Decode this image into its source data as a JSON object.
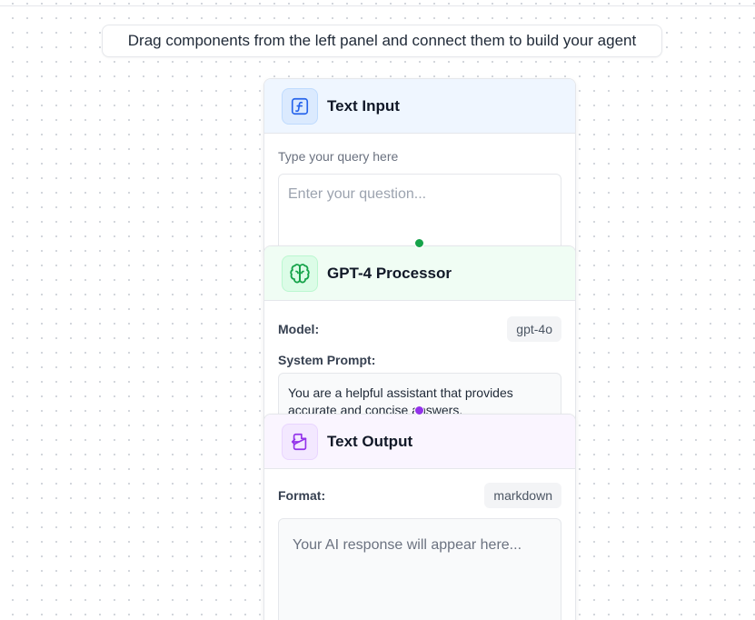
{
  "canvas": {
    "hint_text": "Drag components from the left panel and connect them to build your agent"
  },
  "nodes": {
    "text_input": {
      "title": "Text Input",
      "icon": "function-icon",
      "field_label": "Type your query here",
      "input_placeholder": "Enter your question...",
      "accent": "#2563eb"
    },
    "gpt": {
      "title": "GPT-4 Processor",
      "icon": "brain-icon",
      "model_label": "Model:",
      "model_value": "gpt-4o",
      "system_prompt_label": "System Prompt:",
      "system_prompt_value": "You are a helpful assistant that provides accurate and concise answers.",
      "accent": "#16a34a"
    },
    "text_output": {
      "title": "Text Output",
      "icon": "file-export-icon",
      "format_label": "Format:",
      "format_value": "markdown",
      "output_placeholder": "Your AI response will appear here...",
      "accent": "#9333ea"
    }
  }
}
